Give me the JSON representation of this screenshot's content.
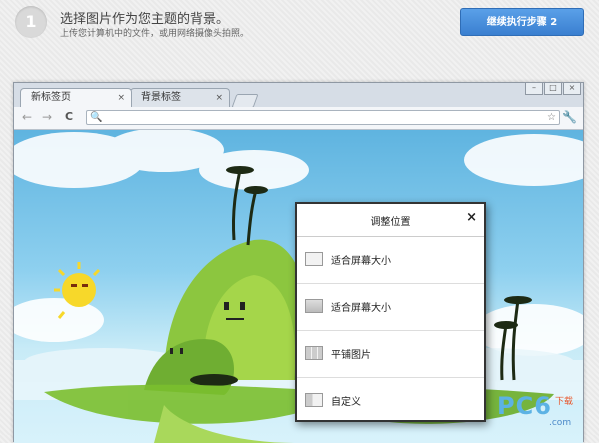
{
  "step": {
    "number": "1",
    "title": "选择图片作为您主题的背景。",
    "subtitle": "上传您计算机中的文件，或用网络摄像头拍照。",
    "next_button": "继续执行步骤 2"
  },
  "browser": {
    "tabs": [
      {
        "label": "新标签页",
        "close": "×"
      },
      {
        "label": "背景标签",
        "close": "×"
      }
    ],
    "nav": {
      "back": "←",
      "forward": "→",
      "reload": "C"
    },
    "omnibox": {
      "value": "",
      "search_icon": "🔍",
      "star_icon": "☆"
    },
    "menu_icon": "🔧",
    "window_controls": [
      "–",
      "□",
      "×"
    ]
  },
  "dialog": {
    "title": "调整位置",
    "close": "×",
    "options": [
      {
        "label": "适合屏幕大小",
        "icon": "fit-screen-icon"
      },
      {
        "label": "适合屏幕大小",
        "icon": "fit-screen-wide-icon"
      },
      {
        "label": "平铺图片",
        "icon": "tile-icon"
      },
      {
        "label": "自定义",
        "icon": "custom-icon"
      }
    ]
  },
  "watermark": {
    "text": "PC6",
    "sub": "下载",
    "domain": ".com"
  }
}
